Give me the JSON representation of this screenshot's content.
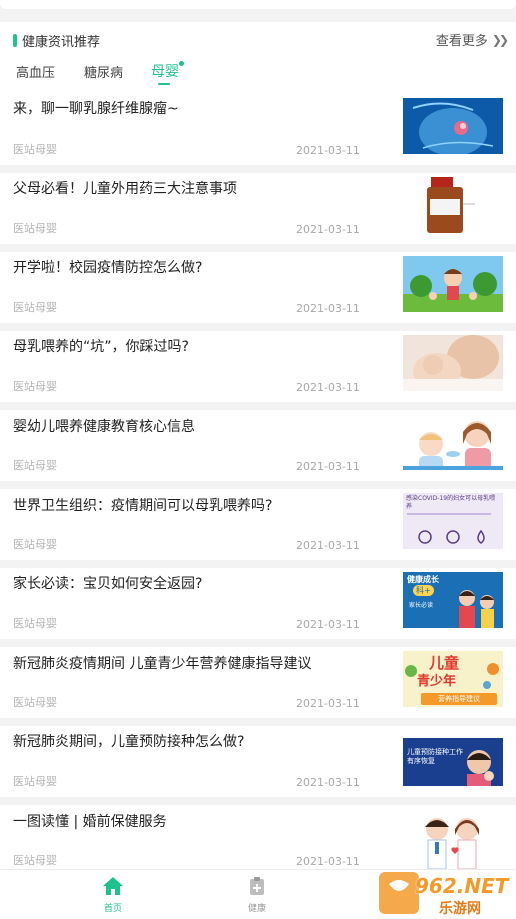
{
  "section": {
    "title": "健康资讯推荐",
    "see_more": "查看更多",
    "tabs": [
      {
        "label": "高血压",
        "active": false
      },
      {
        "label": "糖尿病",
        "active": false
      },
      {
        "label": "母婴",
        "active": true
      }
    ]
  },
  "articles": [
    {
      "title": "来，聊一聊乳腺纤维腺瘤~",
      "source": "医站母婴",
      "date": "2021-03-11",
      "thumb": "breast-anatomy-image"
    },
    {
      "title": "父母必看！儿童外用药三大注意事项",
      "source": "医站母婴",
      "date": "2021-03-11",
      "thumb": "medicine-bottle-image"
    },
    {
      "title": "开学啦！校园疫情防控怎么做?",
      "source": "医站母婴",
      "date": "2021-03-11",
      "thumb": "cartoon-kids-image"
    },
    {
      "title": "母乳喂养的“坑”，你踩过吗?",
      "source": "医站母婴",
      "date": "2021-03-11",
      "thumb": "breastfeeding-photo"
    },
    {
      "title": "婴幼儿喂养健康教育核心信息",
      "source": "医站母婴",
      "date": "2021-03-11",
      "thumb": "mother-feeding-baby-illustration"
    },
    {
      "title": "世界卫生组织：疫情期间可以母乳喂养吗?",
      "source": "医站母婴",
      "date": "2021-03-11",
      "thumb": "who-breastfeeding-poster"
    },
    {
      "title": "家长必读：宝贝如何安全返园?",
      "source": "医站母婴",
      "date": "2021-03-11",
      "thumb": "parent-science-poster"
    },
    {
      "title": "新冠肺炎疫情期间 儿童青少年营养健康指导建议",
      "source": "医站母婴",
      "date": "2021-03-11",
      "thumb": "youth-nutrition-poster"
    },
    {
      "title": "新冠肺炎期间，儿童预防接种怎么做?",
      "source": "医站母婴",
      "date": "2021-03-11",
      "thumb": "vaccination-poster"
    },
    {
      "title": "一图读懂 | 婚前保健服务",
      "source": "医站母婴",
      "date": "2021-03-11",
      "thumb": "couple-cartoon-image"
    }
  ],
  "thumb_text": {
    "poster6": "感染COVID-19的妇女可以母乳喂养",
    "poster7_a": "健康成长",
    "poster7_b": "科+",
    "poster7_c": "家长必读",
    "poster8_a": "儿童",
    "poster8_b": "青少年",
    "poster8_c": "营养指导建议",
    "poster9": "儿童预防接种工作有序恢复"
  },
  "nav": [
    {
      "label": "首页",
      "icon": "home-icon",
      "active": true
    },
    {
      "label": "健康",
      "icon": "clipboard-plus-icon",
      "active": false
    }
  ],
  "watermark": {
    "line1": "962.NET",
    "line2": "乐游网"
  },
  "colors": {
    "accent": "#1ec28b",
    "bg": "#f3f3f3"
  }
}
